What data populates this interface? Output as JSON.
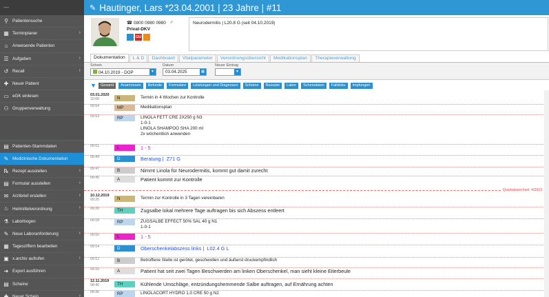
{
  "header": {
    "title": "Hautinger, Lars *23.04.2001 | 23 Jahre | #11"
  },
  "sidebar": {
    "top_label": "---",
    "items": [
      {
        "label": "Patientensuche",
        "arrow": false
      },
      {
        "label": "Terminplaner",
        "arrow": true
      },
      {
        "label": "Anwesende Patienten",
        "arrow": false
      },
      {
        "label": "Aufgaben",
        "arrow": true
      },
      {
        "label": "Recall",
        "arrow": true
      },
      {
        "label": "Neuer Patient",
        "arrow": false
      },
      {
        "label": "eGK einlesen",
        "arrow": false
      },
      {
        "label": "Gruppenverwaltung",
        "arrow": false
      }
    ],
    "items2": [
      {
        "label": "Patienten-Stammdaten",
        "arrow": false
      },
      {
        "label": "Medizinische Dokumentation",
        "arrow": false,
        "active": true
      },
      {
        "label": "Rezept ausstellen",
        "arrow": true
      },
      {
        "label": "Formular ausstellen",
        "arrow": true
      },
      {
        "label": "Arztbrief erstellen",
        "arrow": true
      },
      {
        "label": "Heilmittelverordnung",
        "arrow": true
      },
      {
        "label": "Laborbogen",
        "arrow": false
      },
      {
        "label": "Neue Laboranforderung",
        "arrow": true
      },
      {
        "label": "Tagesziffern bearbeiten",
        "arrow": false
      },
      {
        "label": "x.archiv aufrufen",
        "arrow": true
      },
      {
        "label": "Export ausführen",
        "arrow": false
      },
      {
        "label": "Scheine",
        "arrow": false
      },
      {
        "label": "Neuer Schein",
        "arrow": true
      }
    ]
  },
  "patient": {
    "phone": "0800 0980 0980",
    "insurance": "Privat-DKV",
    "gender_symbol": "♂",
    "badges": [
      {
        "label": "",
        "color": "#2b90cf"
      },
      {
        "label": "GU",
        "color": "#d9261c"
      },
      {
        "label": "",
        "color": "#f08a1c"
      }
    ],
    "diagnosis": "Neurodermitis | L20.8 G (seit 04.10.2019)"
  },
  "tabs": [
    "Dokumentation",
    "L & D",
    "Dashboard",
    "Vitalparameter",
    "Verordnungsübersicht",
    "Medikationsplan",
    "Therapieverwaltung"
  ],
  "selectors": {
    "schein_label": "Schein",
    "schein_value": "04.10.2019 - DOP",
    "datum_label": "Datum",
    "datum_value": "03.04.2025",
    "neuer_label": "Neuer Eintrag",
    "neuer_value": ""
  },
  "chips": [
    "Gesamt",
    "Anamnesen",
    "Befunde",
    "Formulare",
    "Leistungen und Diagnosen",
    "Scheine",
    "Rezepte",
    "Labor",
    "Scheindaten",
    "Falldoku",
    "Impfungen"
  ],
  "entries": [
    {
      "date": "03.01.2020",
      "time": "10:00",
      "code": "N",
      "color": "#c8b67a",
      "text": "Termin in 4 Wochen zur Kontrolle",
      "small": true,
      "textcolor": "#222"
    },
    {
      "date": "",
      "time": "09:54",
      "code": "MP",
      "color": "#d9b99a",
      "text": "Medikationsplan",
      "small": true,
      "textcolor": "#222"
    },
    {
      "date": "",
      "time": "09:53",
      "code": "RP",
      "color": "#bcd6ee",
      "text": "LINOLA FETT CRE 2X250 g N3\n1-0-1\nLINOLA SHAMPOO SHA 200 ml\n2x wöchentlich anwenden",
      "small": true,
      "textcolor": "#222"
    },
    {
      "date": "",
      "time": "09:51",
      "code": "L",
      "color": "#ee22cc",
      "text": "1 - 5",
      "small": false,
      "textcolor": "#d01ac8"
    },
    {
      "date": "",
      "time": "09:49",
      "code": "D",
      "color": "#2b90cf",
      "text": "Beratung |  Z71 G",
      "small": false,
      "textcolor": "#2a4fd6"
    },
    {
      "date": "",
      "time": "09:47",
      "code": "B",
      "color": "#cccccc",
      "text": "Nimmt Linola für Neurodermitis, kommt gut damit zurecht",
      "small": false,
      "textcolor": "#222"
    },
    {
      "date": "",
      "time": "09:45",
      "code": "A",
      "color": "#dddddd",
      "text": "Patient kommt zur Kontrolle",
      "small": false,
      "textcolor": "#222"
    },
    {
      "date": "10.12.2019",
      "time": "09:25",
      "code": "N",
      "color": "#c8b67a",
      "text": "Termin zur Kontrolle in 3 Tagen vereinbaren",
      "small": true,
      "textcolor": "#222"
    },
    {
      "date": "",
      "time": "09:20",
      "code": "TH",
      "color": "#5fd0bd",
      "text": "Zugsalbe lokal mehrere Tage auftragen bis sich Abszess entleert",
      "small": false,
      "textcolor": "#222"
    },
    {
      "date": "",
      "time": "09:18",
      "code": "RP",
      "color": "#bcd6ee",
      "text": "ZUGSALBE EFFECT 50% SAL 40 g N1\n1-0-1",
      "small": true,
      "textcolor": "#222"
    },
    {
      "date": "",
      "time": "09:16",
      "code": "L",
      "color": "#ee22cc",
      "text": "1 - 5",
      "small": false,
      "textcolor": "#d01ac8"
    },
    {
      "date": "",
      "time": "09:14",
      "code": "D",
      "color": "#2b90cf",
      "text": "Oberschenkelabszess links |  L02.4 G L",
      "small": false,
      "textcolor": "#2a4fd6"
    },
    {
      "date": "",
      "time": "09:12",
      "code": "B",
      "color": "#cccccc",
      "text": "Betroffene Stelle ist gerötet, geschwollen und äußerst druckempfindlich",
      "small": true,
      "textcolor": "#222"
    },
    {
      "date": "",
      "time": "09:10",
      "code": "A",
      "color": "#dddddd",
      "text": "Patient hat seit zwei Tagen Beschwerden am linken Oberschenkel, man sieht kleine Eiterbeule",
      "small": false,
      "textcolor": "#222"
    },
    {
      "date": "12.11.2019",
      "time": "08:40",
      "code": "TH",
      "color": "#5fd0bd",
      "text": "Kühlende Umschläge, entzündungshemmende Salbe auftragen, auf Ernährung achten",
      "small": false,
      "textcolor": "#222"
    },
    {
      "date": "",
      "time": "08:36",
      "code": "RP",
      "color": "#bcd6ee",
      "text": "LINOLACORT HYDRO 1,0 CRE 50 g N2",
      "small": true,
      "textcolor": "#222"
    }
  ],
  "quarter_label": "Quartalswechsel: 4/2019"
}
